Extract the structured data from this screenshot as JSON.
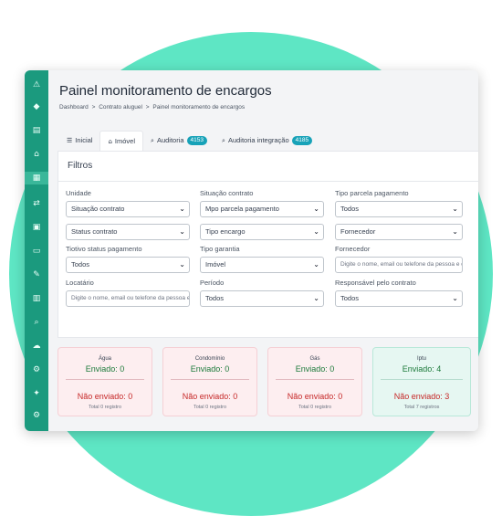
{
  "page": {
    "title": "Painel monitoramento de encargos"
  },
  "breadcrumb": [
    "Dashboard",
    ">",
    "Contrato aluguel",
    ">",
    "Painel monitoramento de encargos"
  ],
  "sidebar": {
    "icons": [
      "alert-icon",
      "diamond-icon",
      "building-icon",
      "home-icon",
      "document-icon",
      "transfer-icon",
      "briefcase-icon",
      "monitor-icon",
      "wrench-icon",
      "file-icon",
      "search-icon",
      "cloud-icon",
      "gear-icon",
      "puzzle-icon",
      "settings-icon"
    ],
    "glyphs": [
      "⚠",
      "◆",
      "▤",
      "⌂",
      "▦",
      "⇄",
      "▣",
      "▭",
      "✎",
      "▥",
      "⌕",
      "☁",
      "⚙",
      "✦",
      "⚙"
    ]
  },
  "tabs": [
    {
      "label": "Inicial",
      "glyph": "☰"
    },
    {
      "label": "Imóvel",
      "glyph": "⌂"
    },
    {
      "label": "Auditoria",
      "glyph": "⌕",
      "badge": "4153"
    },
    {
      "label": "Auditoria integração",
      "glyph": "⌕",
      "badge": "4185"
    }
  ],
  "filters": {
    "title": "Filtros",
    "labels": {
      "unidade": "Unidade",
      "situacao_contrato": "Situação contrato",
      "tipo_parcela": "Tipo parcela pagamento",
      "tipo_status": "Tiotivo status pagamento",
      "tipo_garantia": "Tipo garantia",
      "fornecedor": "Fornecedor",
      "locatario": "Locatário",
      "periodo": "Período",
      "responsavel": "Responsável pelo contrato"
    },
    "values": {
      "situacao_contrato_select": "Situação contrato",
      "status_contrato_select": "Status contrato",
      "tipo_parcela_pagamento_select": "Mpo parcela pagamento",
      "tipo_encargo_select": "Tipo encargo",
      "tipo_parcela_select": "Todos",
      "fornecedor_select": "Fornecedor",
      "tipo_status_select": "Todos",
      "tipo_garantia_select": "Imóvel",
      "periodo_select": "Todos",
      "responsavel_select": "Todos"
    },
    "placeholders": {
      "fornecedor_search": "Digite o nome, email ou telefone da pessoa e di",
      "locatario_search": "Digite o nome, email ou telefone da pessoa e di"
    }
  },
  "cards": [
    {
      "title": "Água",
      "sent": "Enviado: 0",
      "not_sent": "Não enviado: 0",
      "total": "Total 0 registro",
      "status_color": "#fdeef0"
    },
    {
      "title": "Condomínio",
      "sent": "Enviado: 0",
      "not_sent": "Não enviado: 0",
      "total": "Total 0 registro",
      "status_color": "#fdeef0"
    },
    {
      "title": "Gás",
      "sent": "Enviado: 0",
      "not_sent": "Não enviado: 0",
      "total": "Total 0 registro",
      "status_color": "#fdeef0"
    },
    {
      "title": "Iptu",
      "sent": "Enviado: 4",
      "not_sent": "Não enviado: 3",
      "total": "Total 7 registros",
      "status_color": "#e6f7f2"
    }
  ],
  "colors": {
    "accent": "#1b9a7e",
    "sent": "#1c7a3a",
    "not_sent": "#c62828",
    "badge": "#17a2b8"
  }
}
